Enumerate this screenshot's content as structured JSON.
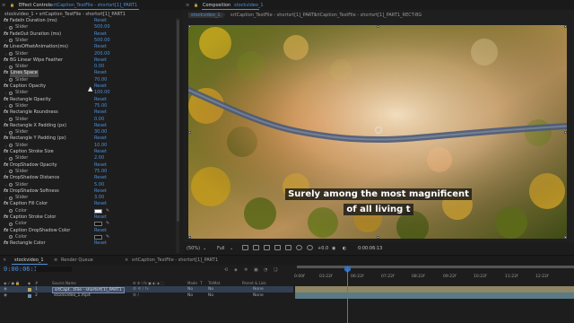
{
  "effect_controls": {
    "menu_glyph": "≡",
    "lock_glyph": "🔒",
    "tab_label": "Effect Controls",
    "layer_label": "srtCaption_TestFile - shortsrt[1]_PART1",
    "breadcrumb": "stockvideo_1 • srtCaption_TestFile - shortsrt[1]_PART1",
    "reset_label": "Reset",
    "rows": [
      {
        "kind": "prop",
        "name": "FadeIn Duration (ms)",
        "right": "Reset"
      },
      {
        "kind": "sub",
        "name": "Slider",
        "right": "500.00"
      },
      {
        "kind": "prop",
        "name": "FadeOut Duration (ms)",
        "right": "Reset"
      },
      {
        "kind": "sub",
        "name": "Slider",
        "right": "500.00"
      },
      {
        "kind": "prop",
        "name": "LinesOffsetAnimation(ms)",
        "right": "Reset"
      },
      {
        "kind": "sub",
        "name": "Slider",
        "right": "200.00"
      },
      {
        "kind": "prop",
        "name": "BG Linear Wipe Feather",
        "right": "Reset"
      },
      {
        "kind": "sub",
        "name": "Slider",
        "right": "0.00"
      },
      {
        "kind": "prop",
        "name": "Lines Space",
        "right": "Reset",
        "highlight": true
      },
      {
        "kind": "sub",
        "name": "Slider",
        "right": "70.00"
      },
      {
        "kind": "prop",
        "name": "Caption Opacity",
        "right": "Reset"
      },
      {
        "kind": "sub",
        "name": "Slider",
        "right": "100.00"
      },
      {
        "kind": "prop",
        "name": "Rectangle Opacity",
        "right": "Reset"
      },
      {
        "kind": "sub",
        "name": "Slider",
        "right": "75.00"
      },
      {
        "kind": "prop",
        "name": "Rectangle Roundness",
        "right": "Reset"
      },
      {
        "kind": "sub",
        "name": "Slider",
        "right": "0.00"
      },
      {
        "kind": "prop",
        "name": "Rectangle X Padding (px)",
        "right": "Reset"
      },
      {
        "kind": "sub",
        "name": "Slider",
        "right": "30.00"
      },
      {
        "kind": "prop",
        "name": "Rectangle Y Padding (px)",
        "right": "Reset"
      },
      {
        "kind": "sub",
        "name": "Slider",
        "right": "10.00"
      },
      {
        "kind": "prop",
        "name": "Caption Stroke Size",
        "right": "Reset"
      },
      {
        "kind": "sub",
        "name": "Slider",
        "right": "2.00"
      },
      {
        "kind": "prop",
        "name": "DropShadow Opacity",
        "right": "Reset"
      },
      {
        "kind": "sub",
        "name": "Slider",
        "right": "75.00"
      },
      {
        "kind": "prop",
        "name": "DropShadow Distance",
        "right": "Reset"
      },
      {
        "kind": "sub",
        "name": "Slider",
        "right": "5.00"
      },
      {
        "kind": "prop",
        "name": "DropShadow Softness",
        "right": "Reset"
      },
      {
        "kind": "sub",
        "name": "Slider",
        "right": "3.00"
      },
      {
        "kind": "prop",
        "name": "Caption Fill Color",
        "right": "Reset"
      },
      {
        "kind": "color",
        "name": "Color",
        "swatch": "#ffffff"
      },
      {
        "kind": "prop",
        "name": "Caption Stroke Color",
        "right": "Reset"
      },
      {
        "kind": "color",
        "name": "Color",
        "swatch": "#111111"
      },
      {
        "kind": "prop",
        "name": "Caption DropShadow Color",
        "right": "Reset"
      },
      {
        "kind": "color",
        "name": "Color",
        "swatch": "#111111"
      },
      {
        "kind": "prop",
        "name": "Rectangle Color",
        "right": "Reset"
      }
    ]
  },
  "composition": {
    "menu_glyph": "≡",
    "lock_glyph": "🔒",
    "tab_label": "Composition",
    "tab_name": "stockvideo_1",
    "breadcrumbs": [
      "stockvideo_1",
      "srtCaption_TestFile - shortsrt[1]_PART1",
      "srtCaption_TestFile - shortsrt[1]_PART1_RECT-BG"
    ],
    "crumb_separator": "‹",
    "caption_lines": [
      "Surely among the most magnificent",
      "of all living t"
    ],
    "footer": {
      "zoom": "(50%)",
      "resolution": "Full",
      "exposure": "+0.0",
      "timecode": "0:00:06:13"
    }
  },
  "timeline": {
    "close_glyph": "×",
    "tabs": [
      "stockvideo_1",
      "Render Queue",
      "srtCaption_TestFile - shortsrt[1]_PART1"
    ],
    "timecode": "0:00:06:13",
    "columns": {
      "source_name": "Source Name",
      "mode": "Mode",
      "t": "T",
      "trkmat": "TrkMat",
      "parent": "Parent & Link"
    },
    "ruler_ticks": [
      "0:00f",
      "03:22f",
      "06:22f",
      "07:22f",
      "08:22f",
      "09:22f",
      "10:22f",
      "11:22f",
      "12:22f"
    ],
    "layers": [
      {
        "num": "1",
        "name": "srtCapt...tFile - shortsrt[1]_PART1",
        "mode": "No",
        "trkmat": "No",
        "parent": "None",
        "label_color": "#b8a86a"
      },
      {
        "num": "2",
        "name": "stockvideo_1.mp4",
        "mode": "No",
        "trkmat": "No",
        "parent": "None",
        "label_color": "#6a8fb0"
      }
    ],
    "tools": [
      "⟲",
      "◈",
      "✲",
      "▣",
      "◔",
      "❏"
    ]
  }
}
